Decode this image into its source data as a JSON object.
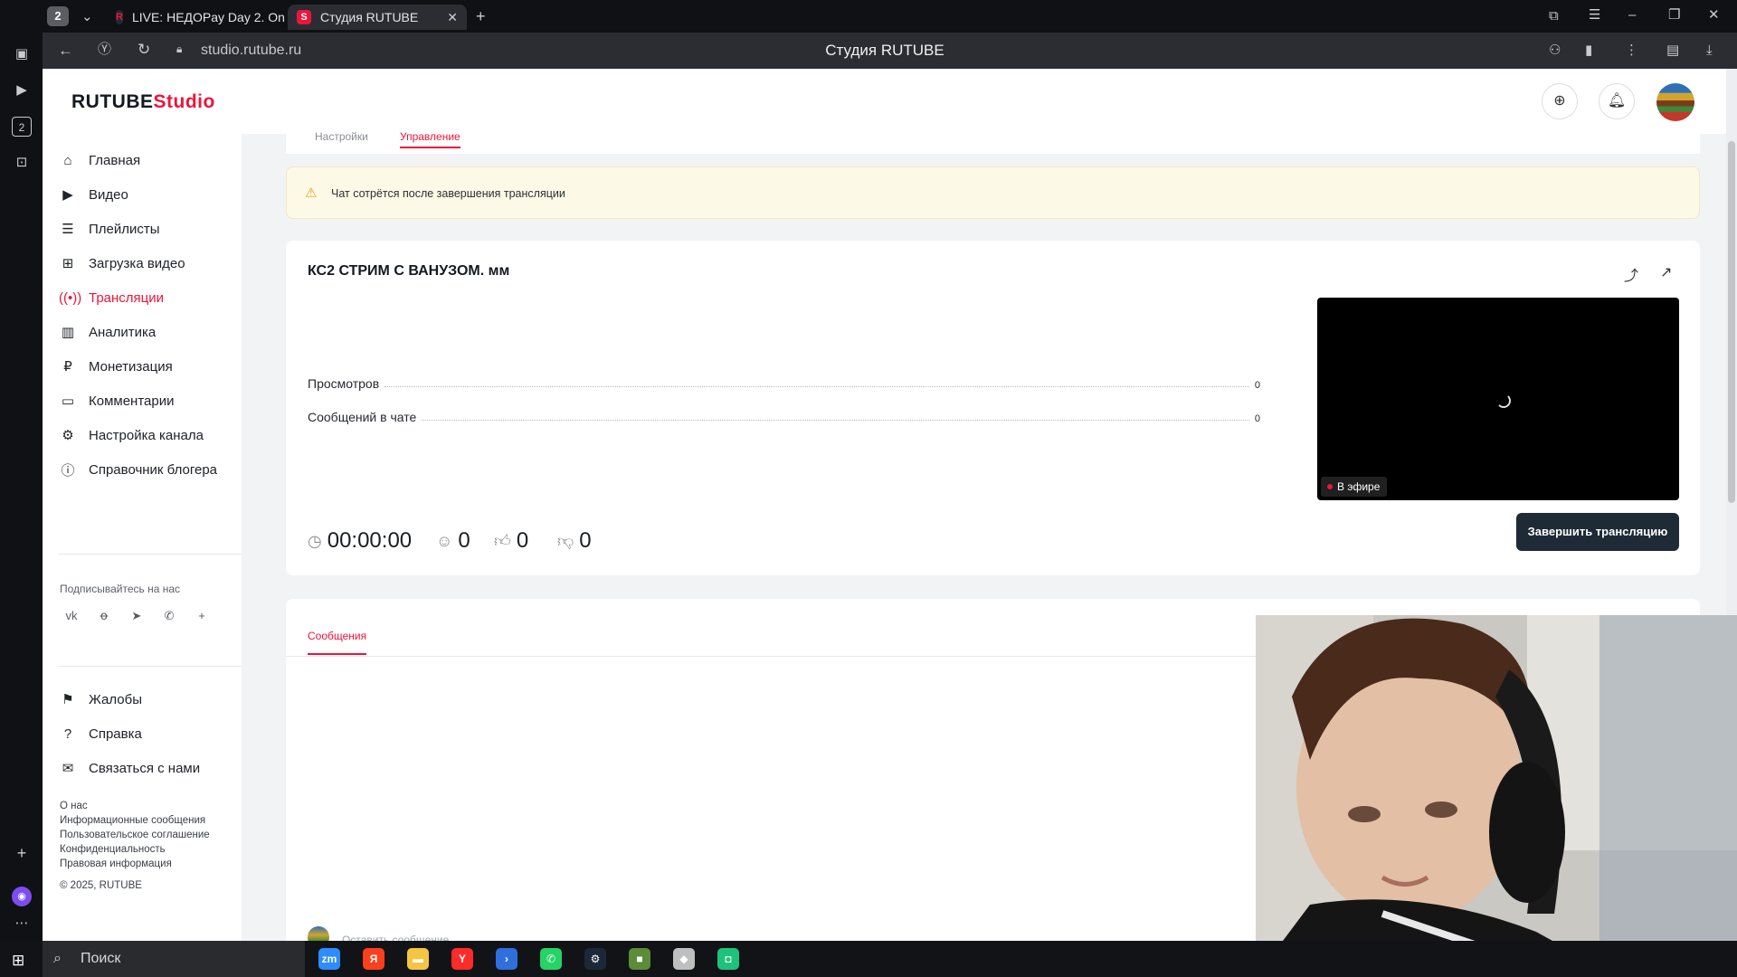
{
  "browser": {
    "tab_count": "2",
    "tabs": [
      {
        "title": "LIVE: НЕДОPay Day 2. On",
        "favicon": "R"
      },
      {
        "title": "Студия RUTUBE",
        "favicon": "S"
      }
    ],
    "url": "studio.rutube.ru",
    "page_title": "Студия RUTUBE"
  },
  "header": {
    "logo_main": "RUTUBE",
    "logo_sub": "Studio"
  },
  "nav": {
    "items": [
      {
        "label": "Главная",
        "icon": "home-icon"
      },
      {
        "label": "Видео",
        "icon": "video-icon"
      },
      {
        "label": "Плейлисты",
        "icon": "playlist-icon"
      },
      {
        "label": "Загрузка видео",
        "icon": "upload-icon"
      },
      {
        "label": "Трансляции",
        "icon": "broadcast-icon"
      },
      {
        "label": "Аналитика",
        "icon": "analytics-icon"
      },
      {
        "label": "Монетизация",
        "icon": "ruble-icon"
      },
      {
        "label": "Комментарии",
        "icon": "comment-icon"
      },
      {
        "label": "Настройка канала",
        "icon": "gear-icon"
      },
      {
        "label": "Справочник блогера",
        "icon": "info-icon"
      }
    ],
    "follow_label": "Подписывайтесь на нас",
    "social": [
      "vk-icon",
      "ok-icon",
      "telegram-icon",
      "viber-icon",
      "plus-icon"
    ],
    "bottom_items": [
      {
        "label": "Жалобы",
        "icon": "flag-icon"
      },
      {
        "label": "Справка",
        "icon": "help-icon"
      },
      {
        "label": "Связаться с нами",
        "icon": "mail-icon"
      }
    ],
    "footer_links": [
      "О нас",
      "Информационные сообщения",
      "Пользовательское соглашение",
      "Конфиденциальность",
      "Правовая информация"
    ],
    "copyright": "© 2025, RUTUBE"
  },
  "tabs_top": {
    "settings": "Настройки",
    "manage": "Управление"
  },
  "warning": {
    "text": "Чат сотрётся после завершения трансляции"
  },
  "stream": {
    "title": "КС2 СТРИМ С ВАНУЗОМ. мм",
    "stats": [
      {
        "label": "Просмотров",
        "value": "0"
      },
      {
        "label": "Сообщений в чате",
        "value": "0"
      }
    ],
    "live_label": "В эфире",
    "duration": "00:00:00",
    "viewers": "0",
    "likes": "0",
    "dislikes": "0",
    "end_button": "Завершить трансляцию"
  },
  "messages": {
    "tab": "Сообщения",
    "placeholder": "Оставить сообщение"
  },
  "taskbar": {
    "search": "Поиск",
    "apps": [
      {
        "name": "zoom",
        "label": "zm",
        "color": "#2d8cff"
      },
      {
        "name": "yandex",
        "label": "Я",
        "color": "#fc3f1d"
      },
      {
        "name": "explorer",
        "label": "▬",
        "color": "#f4c542"
      },
      {
        "name": "yandex-browser",
        "label": "Y",
        "color": "#ff2a2a"
      },
      {
        "name": "arrow-app",
        "label": "›",
        "color": "#2f6fdc"
      },
      {
        "name": "whatsapp",
        "label": "✆",
        "color": "#25d366"
      },
      {
        "name": "steam",
        "label": "⚙",
        "color": "#1b2838"
      },
      {
        "name": "minecraft",
        "label": "■",
        "color": "#5b8c3a"
      },
      {
        "name": "roblox",
        "label": "◆",
        "color": "#bfbfbf"
      },
      {
        "name": "app-green",
        "label": "◘",
        "color": "#1fc27a"
      }
    ]
  }
}
